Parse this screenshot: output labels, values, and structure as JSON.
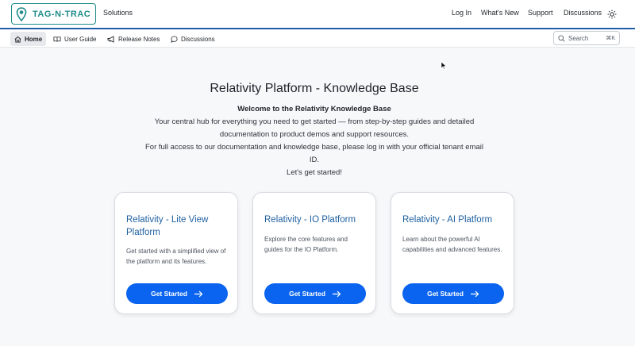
{
  "header": {
    "logo_text": "TAG-N-TRAC",
    "solutions": "Solutions",
    "nav": {
      "login": "Log In",
      "whats_new": "What's New",
      "support": "Support",
      "discussions": "Discussions"
    },
    "theme_icon": "sun-icon"
  },
  "subnav": {
    "tabs": [
      {
        "label": "Home",
        "icon": "home-icon",
        "active": true
      },
      {
        "label": "User Guide",
        "icon": "book-icon"
      },
      {
        "label": "Release Notes",
        "icon": "megaphone-icon"
      },
      {
        "label": "Discussions",
        "icon": "chat-icon"
      }
    ],
    "search": {
      "placeholder": "Search",
      "shortcut": "⌘K"
    }
  },
  "main": {
    "title": "Relativity Platform - Knowledge Base",
    "intro_heading": "Welcome to the Relativity Knowledge Base",
    "intro_line1": "Your central hub for everything you need to get started — from step-by-step guides and detailed documentation to product demos and support resources.",
    "intro_line2": "For full access to our documentation and knowledge base, please log in with your official tenant email ID.",
    "intro_line3": "Let's get started!"
  },
  "cards": [
    {
      "title": "Relativity - Lite View Platform",
      "desc": "Get started with a simplified view of the platform and its features.",
      "button": "Get Started"
    },
    {
      "title": "Relativity - IO Platform",
      "desc": "Explore the core features and guides for the IO Platform.",
      "button": "Get Started"
    },
    {
      "title": "Relativity - AI Platform",
      "desc": "Learn about the powerful AI capabilities and advanced features.",
      "button": "Get Started"
    }
  ],
  "colors": {
    "brand": "#1e8c8a",
    "accent_line": "#1f5fa8",
    "button": "#0a64ef",
    "card_title": "#1d5f9f"
  }
}
